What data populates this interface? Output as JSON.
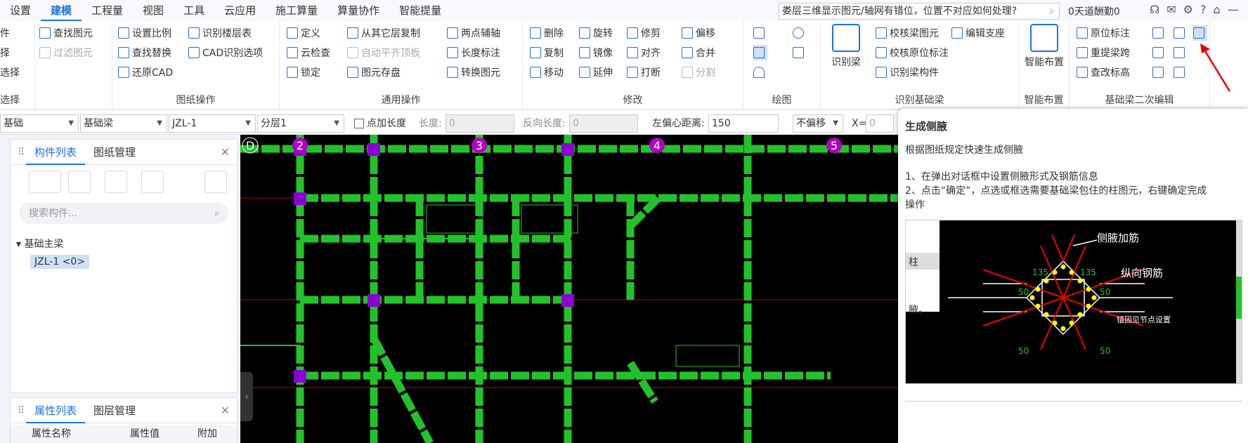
{
  "menu": {
    "items": [
      "设置",
      "建模",
      "工程量",
      "视图",
      "工具",
      "云应用",
      "施工算量",
      "算量协作",
      "智能提量"
    ],
    "active": "建模"
  },
  "notice": "娄层三维显示图元/轴网有错位，位置不对应如何处理?",
  "trial": "0天道酬勤0",
  "ribbon": {
    "g1": {
      "title": "选择",
      "items": [
        "件",
        "择",
        "选择"
      ]
    },
    "g2": {
      "items": [
        "查找图元",
        "过滤图元"
      ]
    },
    "g3": {
      "title": "图纸操作",
      "items": [
        "设置比例",
        "识别楼层表",
        "查找替换",
        "CAD识别选项",
        "还原CAD"
      ]
    },
    "g4": {
      "title": "通用操作",
      "items": [
        "定义",
        "从其它层复制",
        "两点辅轴",
        "云检查",
        "自动平齐顶板",
        "长度标注",
        "锁定",
        "图元存盘",
        "转换图元"
      ]
    },
    "g5": {
      "title": "修改",
      "items": [
        "删除",
        "旋转",
        "修剪",
        "偏移",
        "复制",
        "镜像",
        "对齐",
        "合并",
        "移动",
        "延伸",
        "打断",
        "分割"
      ]
    },
    "g6": {
      "title": "绘图"
    },
    "g7": {
      "title": "识别基础梁",
      "big": "识别梁",
      "items": [
        "校核梁图元",
        "编辑支座",
        "校核原位标注",
        "识别梁构件"
      ]
    },
    "g8": {
      "title": "智能布置",
      "big": "智能布置"
    },
    "g9": {
      "title": "基础梁二次编辑",
      "items": [
        "原位标注",
        "重提梁跨",
        "查改标高"
      ]
    }
  },
  "toolbar2": {
    "floor": "基础",
    "type": "基础梁",
    "name": "JZL-1",
    "layer": "分层1",
    "add_length": "点加长度",
    "length_label": "长度:",
    "length_value": "0",
    "rev_label": "反向长度:",
    "rev_value": "0",
    "offset_label": "左偏心距离:",
    "offset_value": "150",
    "shift": "不偏移",
    "x_label": "X=",
    "x_value": "0"
  },
  "panel1": {
    "tabs": [
      "构件列表",
      "图纸管理"
    ],
    "search_placeholder": "搜索构件...",
    "tree_title": "基础主梁",
    "tree_item": "JZL-1 <0>"
  },
  "panel2": {
    "tabs": [
      "属性列表",
      "图层管理"
    ],
    "cols": [
      "属性名称",
      "属性值",
      "附加"
    ]
  },
  "canvas": {
    "axis_labels": [
      "D",
      "2",
      "3",
      "4",
      "5"
    ]
  },
  "tooltip": {
    "title": "生成侧腋",
    "desc": "根据图纸规定快速生成侧腋",
    "steps": [
      "1、在弹出对话框中设置侧腋形式及钢筋信息",
      "2、点击“确定”，点选或框选需要基础梁包住的柱图元，右键确定完成",
      "操作"
    ],
    "fig_labels": {
      "a": "侧腋加筋",
      "b": "纵向钢筋",
      "n135a": "135",
      "n135b": "135",
      "n50a": "50",
      "n50b": "50",
      "n50c": "50",
      "n50d": "50",
      "anchor": "锚固见节点设置",
      "side1": "柱",
      "side2": "腋。"
    }
  },
  "colors": {
    "accent": "#1a73e8",
    "beam": "#22c32a",
    "column": "#8a00d4",
    "canvas_bg": "#000000"
  }
}
